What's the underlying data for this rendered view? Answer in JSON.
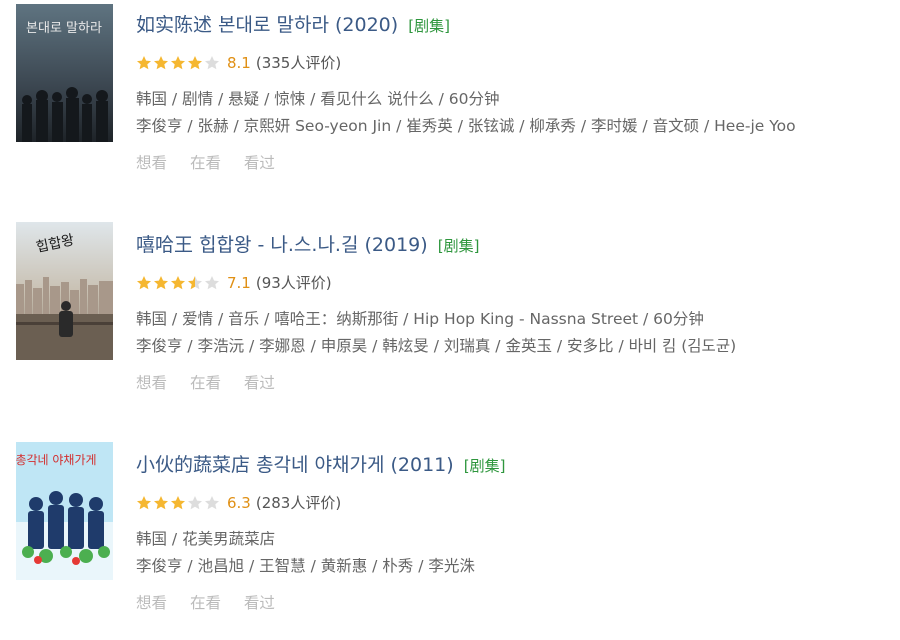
{
  "items": [
    {
      "title": "如实陈述 본대로 말하라 (2020)",
      "tag": "[剧集]",
      "stars_filled": 4,
      "stars_half": 0,
      "score": "8.1",
      "votes": "(335人评价)",
      "meta": "韩国 / 剧情 / 悬疑 / 惊悚 / 看见什么 说什么 / 60分钟",
      "cast": "李俊亨 / 张赫 / 京熙妍 Seo-yeon Jin / 崔秀英 / 张铉诚 / 柳承秀 / 李时媛 / 音文硕 / Hee-je Yoo",
      "actions": [
        "想看",
        "在看",
        "看过"
      ],
      "poster_text": "본대로 말하라"
    },
    {
      "title": "嘻哈王 힙합왕 - 나.스.나.길 (2019)",
      "tag": "[剧集]",
      "stars_filled": 3,
      "stars_half": 1,
      "score": "7.1",
      "votes": "(93人评价)",
      "meta": "韩国 / 爱情 / 音乐 / 嘻哈王：纳斯那街 / Hip Hop King - Nassna Street / 60分钟",
      "cast": "李俊亨 / 李浩沅 / 李娜恩 / 申原昊 / 韩炫旻 / 刘瑞真 / 金英玉 / 安多比 / 바비 킴 (김도균)",
      "actions": [
        "想看",
        "在看",
        "看过"
      ],
      "poster_text": "힙합왕"
    },
    {
      "title": "小伙的蔬菜店 총각네 야채가게 (2011)",
      "tag": "[剧集]",
      "stars_filled": 3,
      "stars_half": 0,
      "score": "6.3",
      "votes": "(283人评价)",
      "meta": "韩国 / 花美男蔬菜店",
      "cast": "李俊亨 / 池昌旭 / 王智慧 / 黄新惠 / 朴秀 / 李光洙",
      "actions": [
        "想看",
        "在看",
        "看过"
      ],
      "poster_text": "총각네 야채가게"
    }
  ],
  "colors": {
    "title": "#3b5a86",
    "tag": "#2e963d",
    "score": "#e09015",
    "star_on": "#f5b731",
    "star_off": "#dddddd"
  }
}
